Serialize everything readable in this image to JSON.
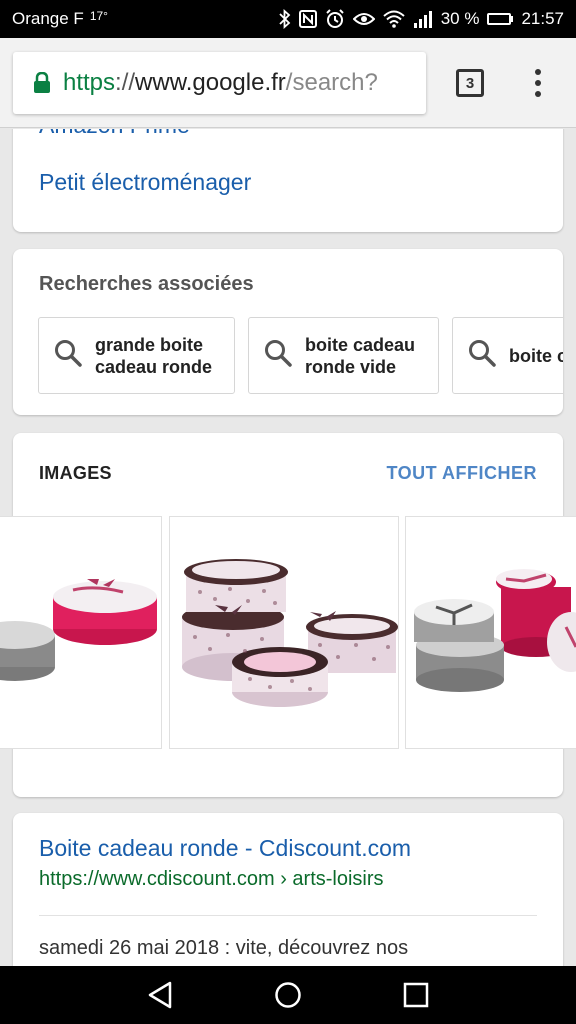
{
  "status_bar": {
    "carrier": "Orange F",
    "temperature": "17°",
    "battery_percent": "30 %",
    "battery_level": 0.3,
    "time": "21:57"
  },
  "browser": {
    "url_scheme": "https",
    "url_separator": "://",
    "url_host": "www.google.fr",
    "url_path": "/search?",
    "tab_count": "3"
  },
  "prev_section": {
    "cut_link": "Amazon Prime",
    "link": "Petit électroménager"
  },
  "related": {
    "title": "Recherches associées",
    "chips": [
      {
        "line1": "grande boite",
        "line2": "cadeau ronde"
      },
      {
        "line1": "boite cadeau",
        "line2": "ronde vide"
      },
      {
        "line1": "boite c",
        "line2": ""
      }
    ]
  },
  "images": {
    "title": "IMAGES",
    "see_all": "TOUT AFFICHER"
  },
  "result": {
    "title": "Boite cadeau ronde - Cdiscount.com",
    "url": "https://www.cdiscount.com › arts-loisirs",
    "snippet": "samedi 26 mai 2018 : vite, découvrez nos"
  },
  "colors": {
    "link": "#1a5eab",
    "url_green": "#0b8043",
    "result_url": "#0b6b2b",
    "see_all": "#4f86c6"
  },
  "icons": [
    "bluetooth-icon",
    "nfc-icon",
    "alarm-icon",
    "eye-icon",
    "wifi-icon",
    "signal-icon",
    "battery-icon",
    "lock-icon",
    "tabs-icon",
    "overflow-menu-icon",
    "search-icon",
    "back-icon",
    "home-icon",
    "recents-icon"
  ]
}
